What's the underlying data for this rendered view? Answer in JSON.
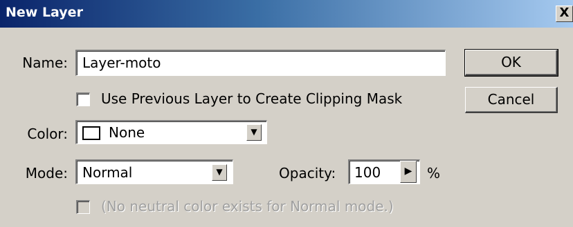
{
  "window": {
    "title": "New Layer",
    "close_glyph": "X"
  },
  "name_row": {
    "label": "Name:",
    "value": "Layer-moto"
  },
  "clipping_mask": {
    "label": "Use Previous Layer to Create Clipping Mask",
    "checked": false
  },
  "color_row": {
    "label": "Color:",
    "value": "None",
    "swatch_color": "#ffffff"
  },
  "mode_row": {
    "label": "Mode:",
    "value": "Normal"
  },
  "opacity": {
    "label": "Opacity:",
    "value": "100",
    "unit": "%"
  },
  "neutral_color": {
    "label": "(No neutral color exists for Normal mode.)",
    "enabled": false
  },
  "buttons": {
    "ok": "OK",
    "cancel": "Cancel"
  },
  "icons": {
    "close": "close-icon",
    "dropdown": "chevron-down-icon",
    "slider_popup": "triangle-right-icon"
  },
  "colors": {
    "titlebar_start": "#0a246a",
    "titlebar_end": "#a6caf0",
    "dialog_bg": "#d4d0c8"
  }
}
